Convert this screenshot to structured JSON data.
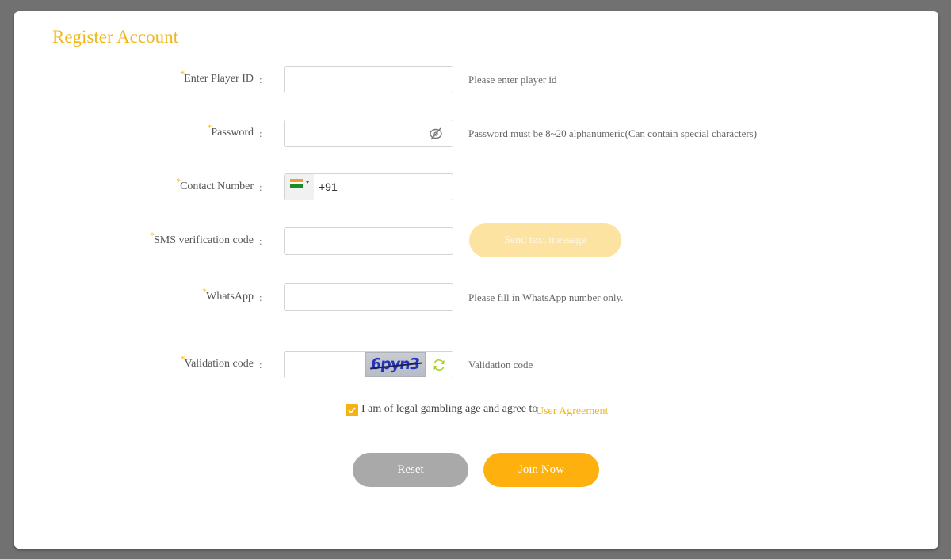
{
  "title": "Register Account",
  "colon": ":",
  "required_marker": "*",
  "fields": {
    "player_id": {
      "label": "Enter Player ID",
      "value": "",
      "hint": "Please enter player id"
    },
    "password": {
      "label": "Password",
      "value": "",
      "hint": "Password must be 8~20 alphanumeric(Can contain special characters)",
      "toggle_icon": "eye-slash-icon"
    },
    "contact_number": {
      "label": "Contact Number",
      "country": "India",
      "flag_icon": "india-flag-icon",
      "value": "+91"
    },
    "sms_code": {
      "label": "SMS verification code",
      "value": "",
      "button_label": "Send text message"
    },
    "whatsapp": {
      "label": "WhatsApp",
      "value": "",
      "hint": "Please fill in WhatsApp number only."
    },
    "validation_code": {
      "label": "Validation code",
      "value": "",
      "captcha_text": "6pyn3",
      "refresh_icon": "refresh-icon",
      "hint": "Validation code"
    }
  },
  "agreement": {
    "checked": true,
    "text": "I am of legal gambling age and agree to",
    "link_label": "User Agreement"
  },
  "buttons": {
    "reset_label": "Reset",
    "join_label": "Join Now"
  },
  "colors": {
    "accent": "#f2b71a",
    "join_button": "#fdb00e",
    "reset_button": "#a9a9a9",
    "sms_button_disabled": "#fde3a2",
    "backdrop": "#717171"
  }
}
